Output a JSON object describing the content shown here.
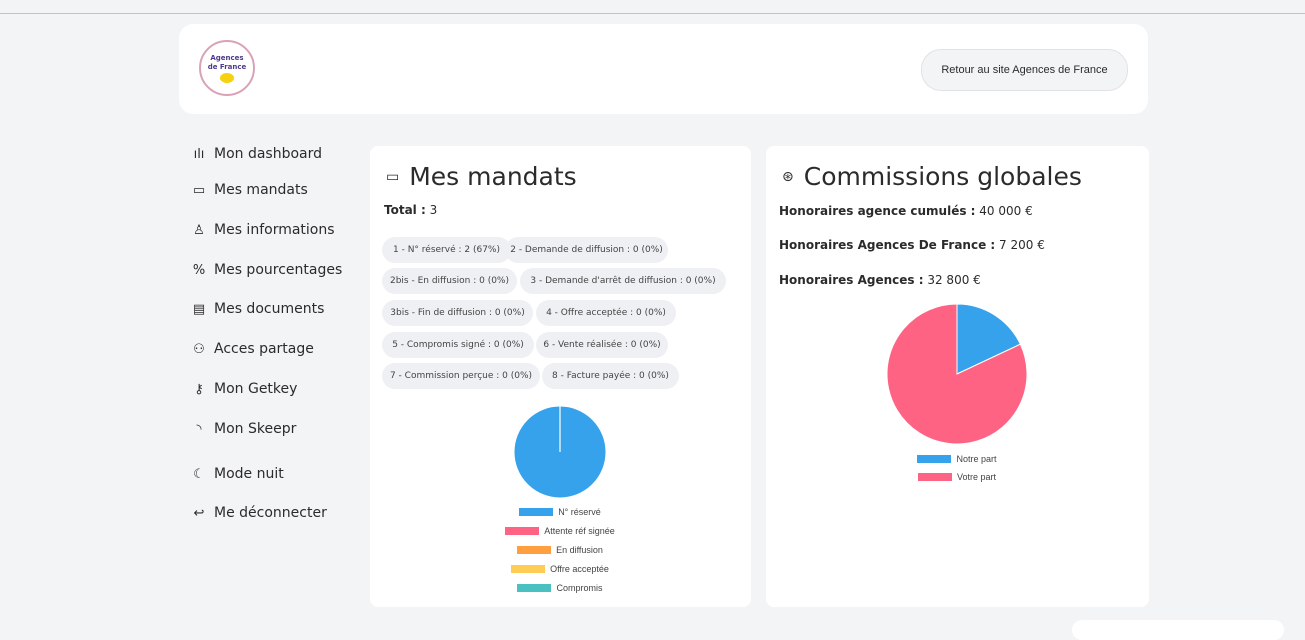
{
  "header": {
    "logo": {
      "line1": "Agences",
      "line2": "de France"
    },
    "back_button": "Retour au site Agences de France"
  },
  "sidebar": {
    "items": [
      {
        "label": "Mon dashboard",
        "icon": "bar-chart-icon",
        "glyph": "ılı"
      },
      {
        "label": "Mes mandats",
        "icon": "folder-icon",
        "glyph": "▭"
      },
      {
        "label": "Mes informations",
        "icon": "user-icon",
        "glyph": "♙"
      },
      {
        "label": "Mes pourcentages",
        "icon": "percent-icon",
        "glyph": "%"
      },
      {
        "label": "Mes documents",
        "icon": "document-icon",
        "glyph": "▤"
      },
      {
        "label": "Acces partage",
        "icon": "users-icon",
        "glyph": "⚇"
      },
      {
        "label": "Mon Getkey",
        "icon": "key-icon",
        "glyph": "⚷"
      },
      {
        "label": "Mon Skeepr",
        "icon": "rss-icon",
        "glyph": "◝"
      },
      {
        "label": "Mode nuit",
        "icon": "moon-icon",
        "glyph": "☾"
      },
      {
        "label": "Me déconnecter",
        "icon": "logout-icon",
        "glyph": "↩"
      }
    ]
  },
  "mandats": {
    "title": "Mes mandats",
    "total_label": "Total :",
    "total_value": "3",
    "statuses": [
      "1 - N° réservé : 2 (67%)",
      "2 - Demande de diffusion : 0 (0%)",
      "2bis - En diffusion : 0 (0%)",
      "3 - Demande d'arrêt de diffusion : 0 (0%)",
      "3bis - Fin de diffusion : 0 (0%)",
      "4 - Offre acceptée : 0 (0%)",
      "5 - Compromis signé : 0 (0%)",
      "6 - Vente réalisée : 0 (0%)",
      "7 - Commission perçue : 0 (0%)",
      "8 - Facture payée : 0 (0%)"
    ]
  },
  "commissions": {
    "title": "Commissions globales",
    "rows": [
      {
        "label": "Honoraires agence cumulés :",
        "value": "40 000 €"
      },
      {
        "label": "Honoraires Agences De France :",
        "value": "7 200 €"
      },
      {
        "label": "Honoraires Agences :",
        "value": "32 800 €"
      }
    ]
  },
  "chart_data": [
    {
      "type": "pie",
      "categories": [
        "N° réservé",
        "Attente réf signée",
        "En diffusion",
        "Offre acceptée",
        "Compromis"
      ],
      "values": [
        2,
        0,
        0,
        0,
        0
      ],
      "colors": [
        "#36a2eb",
        "#ff6384",
        "#ff9f40",
        "#ffcd56",
        "#4bc0c0"
      ],
      "legend": "bottom"
    },
    {
      "type": "pie",
      "categories": [
        "Notre part",
        "Votre part"
      ],
      "values": [
        7200,
        32800
      ],
      "colors": [
        "#36a2eb",
        "#ff6384"
      ],
      "legend": "bottom"
    }
  ]
}
